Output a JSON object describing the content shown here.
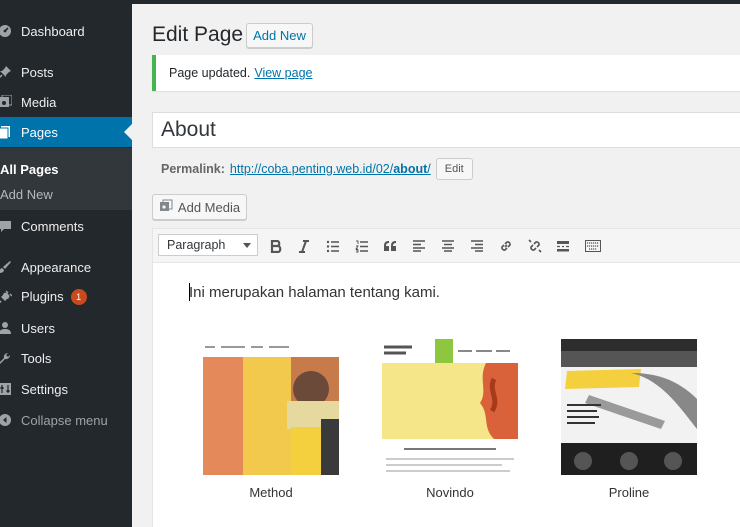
{
  "sidebar": {
    "items": [
      {
        "label": "Dashboard",
        "icon": "dashboard-icon"
      },
      {
        "label": "Posts",
        "icon": "pin-icon"
      },
      {
        "label": "Media",
        "icon": "media-icon"
      },
      {
        "label": "Pages",
        "icon": "page-icon"
      },
      {
        "label": "Comments",
        "icon": "comment-icon"
      },
      {
        "label": "Appearance",
        "icon": "brush-icon"
      },
      {
        "label": "Plugins",
        "icon": "plug-icon",
        "badge": "1"
      },
      {
        "label": "Users",
        "icon": "user-icon"
      },
      {
        "label": "Tools",
        "icon": "wrench-icon"
      },
      {
        "label": "Settings",
        "icon": "settings-icon"
      },
      {
        "label": "Collapse menu",
        "icon": "collapse-icon"
      }
    ],
    "submenu": [
      {
        "label": "All Pages"
      },
      {
        "label": "Add New"
      }
    ]
  },
  "header": {
    "title": "Edit Page",
    "add_new_label": "Add New"
  },
  "notice": {
    "text": "Page updated.",
    "link": "View page"
  },
  "editor": {
    "title_value": "About",
    "permalink_label": "Permalink:",
    "permalink_base": "http://coba.penting.web.id/02/",
    "permalink_slug": "about",
    "permalink_end": "/",
    "edit_label": "Edit",
    "add_media_label": "Add Media",
    "format_select": "Paragraph",
    "content": "Ini merupakan halaman tentang kami."
  },
  "gallery": [
    {
      "caption": "Method"
    },
    {
      "caption": "Novindo"
    },
    {
      "caption": "Proline"
    }
  ],
  "colors": {
    "sidebar_bg": "#23282d",
    "accent": "#0073aa",
    "notice_success": "#46b450",
    "badge": "#ca4a1f"
  }
}
